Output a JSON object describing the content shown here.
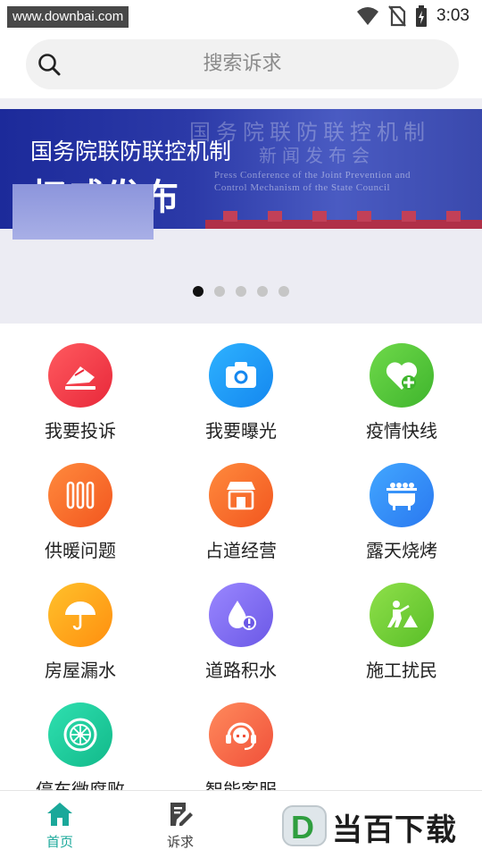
{
  "status_bar": {
    "watermark": "www.downbai.com",
    "time": "3:03"
  },
  "search": {
    "placeholder": "搜索诉求"
  },
  "banner": {
    "title_line1": "国务院联防联控机制",
    "title_line2": "权威发布",
    "bg_title_line1": "国务院联防联控机制",
    "bg_title_line2": "新闻发布会",
    "en_line1": "Press Conference of the Joint Prevention and",
    "en_line2": "Control Mechanism of the State Council",
    "dots_total": 5,
    "active_dot_index": 0
  },
  "services": [
    {
      "label": "我要投诉",
      "icon": "complaint-icon",
      "color_from": "#ff5a5f",
      "color_to": "#e8283a"
    },
    {
      "label": "我要曝光",
      "icon": "camera-icon",
      "color_from": "#2eb2ff",
      "color_to": "#1487ef"
    },
    {
      "label": "疫情快线",
      "icon": "heart-plus-icon",
      "color_from": "#6fd94a",
      "color_to": "#3fb52d"
    },
    {
      "label": "供暖问题",
      "icon": "radiator-icon",
      "color_from": "#ff8a3d",
      "color_to": "#f2561f"
    },
    {
      "label": "占道经营",
      "icon": "stall-icon",
      "color_from": "#ff8a3d",
      "color_to": "#f2561f"
    },
    {
      "label": "露天烧烤",
      "icon": "barbecue-icon",
      "color_from": "#42a7ff",
      "color_to": "#2a78f0"
    },
    {
      "label": "房屋漏水",
      "icon": "umbrella-icon",
      "color_from": "#ffc12b",
      "color_to": "#ff8f0f"
    },
    {
      "label": "道路积水",
      "icon": "water-drop-icon",
      "color_from": "#9a87ff",
      "color_to": "#6b58e6"
    },
    {
      "label": "施工扰民",
      "icon": "construction-worker-icon",
      "color_from": "#8fe04a",
      "color_to": "#59be28"
    },
    {
      "label": "停车微腐败",
      "icon": "wheel-icon",
      "color_from": "#2fe0b0",
      "color_to": "#12b98a"
    },
    {
      "label": "智能客服",
      "icon": "headset-icon",
      "color_from": "#ff8a5c",
      "color_to": "#f0503a"
    }
  ],
  "bottom_nav": {
    "items": [
      {
        "label": "首页",
        "icon": "home-icon",
        "active": true
      },
      {
        "label": "诉求",
        "icon": "edit-document-icon",
        "active": false
      }
    ],
    "watermark_logo_letter": "D",
    "watermark_logo_text": "当百下载"
  },
  "colors": {
    "accent": "#1aa89a",
    "inactive": "#444444"
  }
}
